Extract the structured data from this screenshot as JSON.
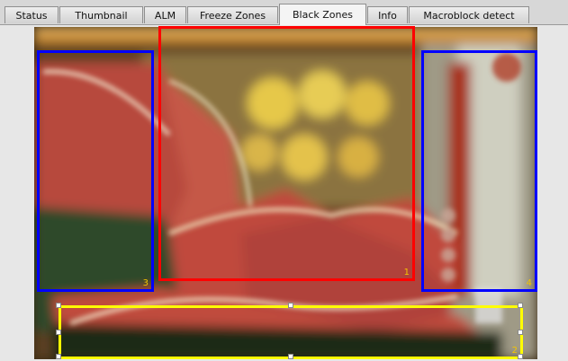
{
  "tabs": [
    {
      "label": "Status",
      "active": false
    },
    {
      "label": "Thumbnail",
      "active": false
    },
    {
      "label": "ALM",
      "active": false
    },
    {
      "label": "Freeze Zones",
      "active": false
    },
    {
      "label": "Black Zones",
      "active": true
    },
    {
      "label": "Info",
      "active": false
    },
    {
      "label": "Macroblock detect",
      "active": false
    }
  ],
  "zones": [
    {
      "number": "1",
      "color": "#ff0000"
    },
    {
      "number": "2",
      "color": "#ffff00"
    },
    {
      "number": "3",
      "color": "#0000ff"
    },
    {
      "number": "4",
      "color": "#0000ff"
    }
  ]
}
